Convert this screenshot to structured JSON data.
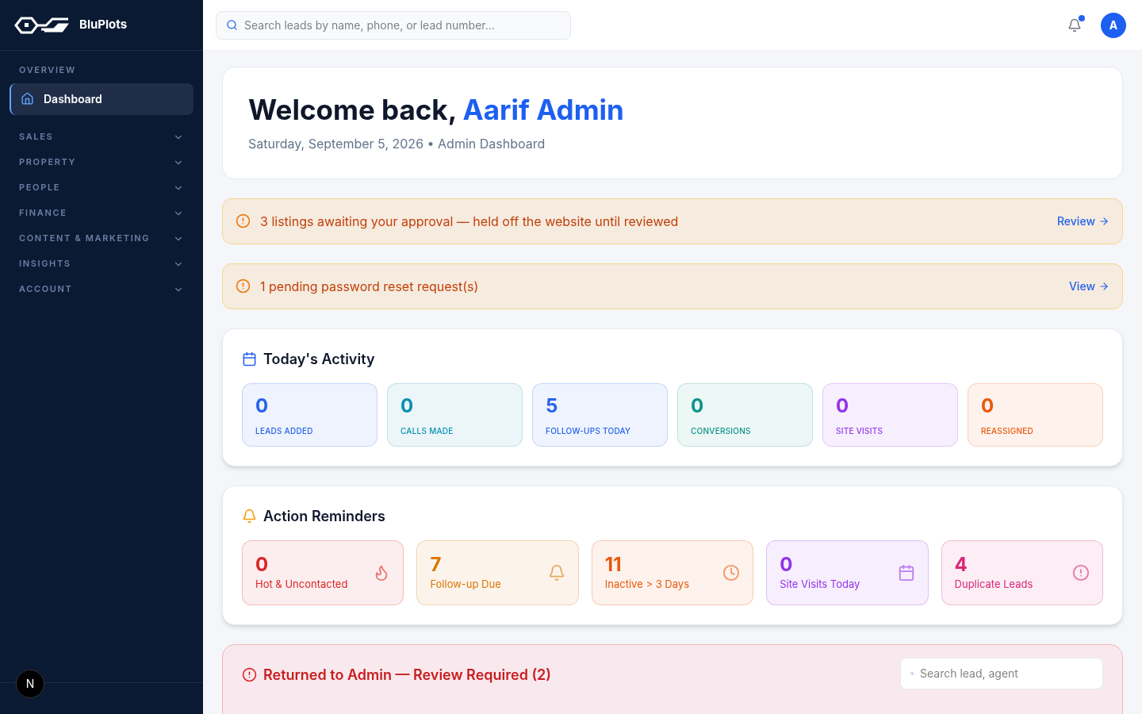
{
  "brand": {
    "name": "BluPlots"
  },
  "sidebar": {
    "section": "OVERVIEW",
    "active_item": {
      "label": "Dashboard",
      "selected": true
    },
    "groups": [
      {
        "label": "SALES",
        "expanded": false
      },
      {
        "label": "PROPERTY",
        "expanded": false
      },
      {
        "label": "PEOPLE",
        "expanded": false
      },
      {
        "label": "FINANCE",
        "expanded": false
      },
      {
        "label": "CONTENT & MARKETING",
        "expanded": false
      },
      {
        "label": "INSIGHTS",
        "expanded": false
      },
      {
        "label": "ACCOUNT",
        "expanded": false
      }
    ],
    "dev_badge": "N"
  },
  "header": {
    "search_placeholder": "Search leads by name, phone, or lead number...",
    "has_notifications": true,
    "avatar": "A"
  },
  "welcome": {
    "greeting": "Welcome back,",
    "name": "Aarif Admin",
    "subtitle": "Saturday, September 5, 2026 • Admin Dashboard"
  },
  "alerts": [
    {
      "message": "3 listings awaiting your approval — held off the website until reviewed",
      "action": "Review"
    },
    {
      "message": "1 pending password reset request(s)",
      "action": "View"
    }
  ],
  "activity": {
    "title": "Today's Activity",
    "tiles": [
      {
        "value": "0",
        "label": "LEADS ADDED",
        "color": "#2563eb"
      },
      {
        "value": "0",
        "label": "CALLS MADE",
        "color": "#0891b2"
      },
      {
        "value": "5",
        "label": "FOLLOW-UPS TODAY",
        "color": "#2563eb"
      },
      {
        "value": "0",
        "label": "CONVERSIONS",
        "color": "#0d9488"
      },
      {
        "value": "0",
        "label": "SITE VISITS",
        "color": "#9333ea"
      },
      {
        "value": "0",
        "label": "REASSIGNED",
        "color": "#ea580c"
      }
    ]
  },
  "reminders": {
    "title": "Action Reminders",
    "tiles": [
      {
        "value": "0",
        "label": "Hot & Uncontacted",
        "kind": "flame",
        "color": "#dc2626"
      },
      {
        "value": "7",
        "label": "Follow-up Due",
        "kind": "bell",
        "color": "#d97706"
      },
      {
        "value": "11",
        "label": "Inactive > 3 Days",
        "kind": "clock",
        "color": "#ea580c"
      },
      {
        "value": "0",
        "label": "Site Visits Today",
        "kind": "calendar",
        "color": "#9333ea"
      },
      {
        "value": "4",
        "label": "Duplicate Leads",
        "kind": "alert",
        "color": "#db2777"
      }
    ]
  },
  "returned": {
    "title": "Returned to Admin — Review Required (2)",
    "search_placeholder": "Search lead, agent"
  }
}
